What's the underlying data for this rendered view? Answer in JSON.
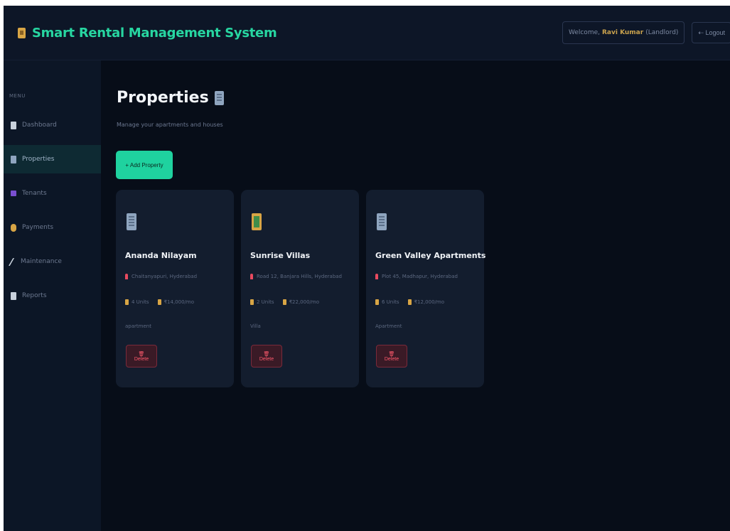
{
  "app": {
    "title": "Smart Rental Management System",
    "welcome_prefix": "Welcome,",
    "user_name": "Ravi Kumar",
    "user_role": "(Landlord)",
    "logout_label": "⇠ Logout"
  },
  "sidebar": {
    "menu_label": "MENU",
    "items": [
      {
        "label": "Dashboard",
        "icon": "dashboard-icon",
        "color": "#c8d1dc"
      },
      {
        "label": "Properties",
        "icon": "building-icon",
        "color": "#8fa5bf"
      },
      {
        "label": "Tenants",
        "icon": "users-icon",
        "color": "#7a4fd0"
      },
      {
        "label": "Payments",
        "icon": "money-bag-icon",
        "color": "#d8a545"
      },
      {
        "label": "Maintenance",
        "icon": "wrench-icon",
        "color": "#c8d1dc"
      },
      {
        "label": "Reports",
        "icon": "report-icon",
        "color": "#c8d1dc"
      }
    ],
    "active_index": 1
  },
  "main": {
    "title": "Properties",
    "subtitle": "Manage your apartments and houses",
    "add_button": "+ Add Property"
  },
  "properties": [
    {
      "name": "Ananda Nilayam",
      "location": "Chaitanyapuri, Hyderabad",
      "units": "4 Units",
      "rent": "₹14,000/mo",
      "type": "apartment",
      "delete_label": "🗑 Delete",
      "icon": "building-icon"
    },
    {
      "name": "Sunrise Villas",
      "location": "Road 12, Banjara Hills, Hyderabad",
      "units": "2 Units",
      "rent": "₹22,000/mo",
      "type": "Villa",
      "delete_label": "🗑 Delete",
      "icon": "house-icon"
    },
    {
      "name": "Green Valley Apartments",
      "location": "Plot 45, Madhapur, Hyderabad",
      "units": "6 Units",
      "rent": "₹12,000/mo",
      "type": "Apartment",
      "delete_label": "🗑 Delete",
      "icon": "building-icon"
    }
  ],
  "colors": {
    "accent": "#27d6a1",
    "background": "#070d18",
    "card": "#131d2e",
    "danger": "#ff5a6d"
  }
}
